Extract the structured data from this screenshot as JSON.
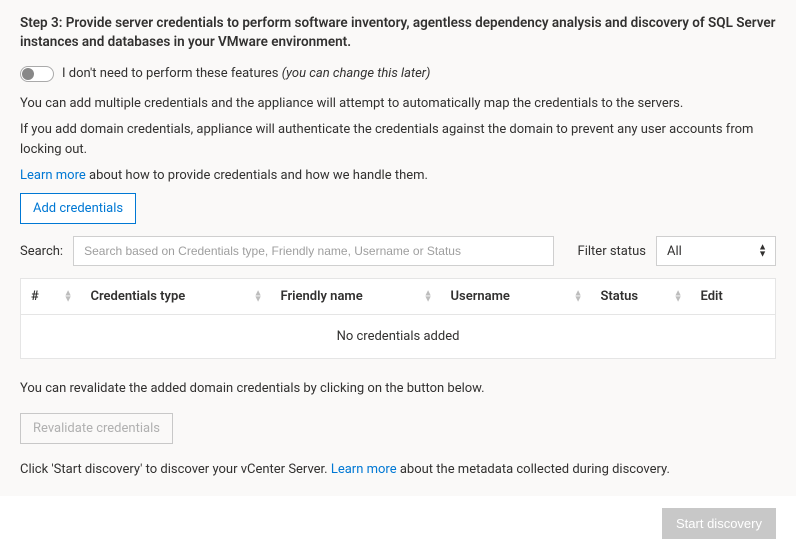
{
  "step_title": "Step 3: Provide server credentials to perform software inventory, agentless dependency analysis and discovery of SQL Server instances and databases in your VMware environment.",
  "toggle": {
    "label_main": "I don't need to perform these features ",
    "label_note": "(you can change this later)"
  },
  "para1": "You can add multiple credentials and the appliance will attempt to automatically map the credentials to the servers.",
  "para2": "If you add domain credentials, appliance will authenticate the credentials against  the domain to prevent any user accounts from locking out.",
  "learn1_link": "Learn more",
  "learn1_rest": " about how to provide credentials and how we handle them.",
  "add_credentials": "Add credentials",
  "search": {
    "label": "Search:",
    "placeholder": "Search based on Credentials type, Friendly name, Username or Status"
  },
  "filter": {
    "label": "Filter status",
    "selected": "All"
  },
  "columns": {
    "num": "#",
    "type": "Credentials type",
    "friendly": "Friendly name",
    "username": "Username",
    "status": "Status",
    "edit": "Edit"
  },
  "empty_row": "No credentials added",
  "revalidate_text": "You can revalidate the added domain credentials by clicking on the button below.",
  "revalidate_btn": "Revalidate credentials",
  "discover_pre": "Click 'Start discovery' to discover your vCenter Server. ",
  "discover_link": "Learn more",
  "discover_post": " about the metadata collected during discovery.",
  "start_discovery": "Start discovery"
}
